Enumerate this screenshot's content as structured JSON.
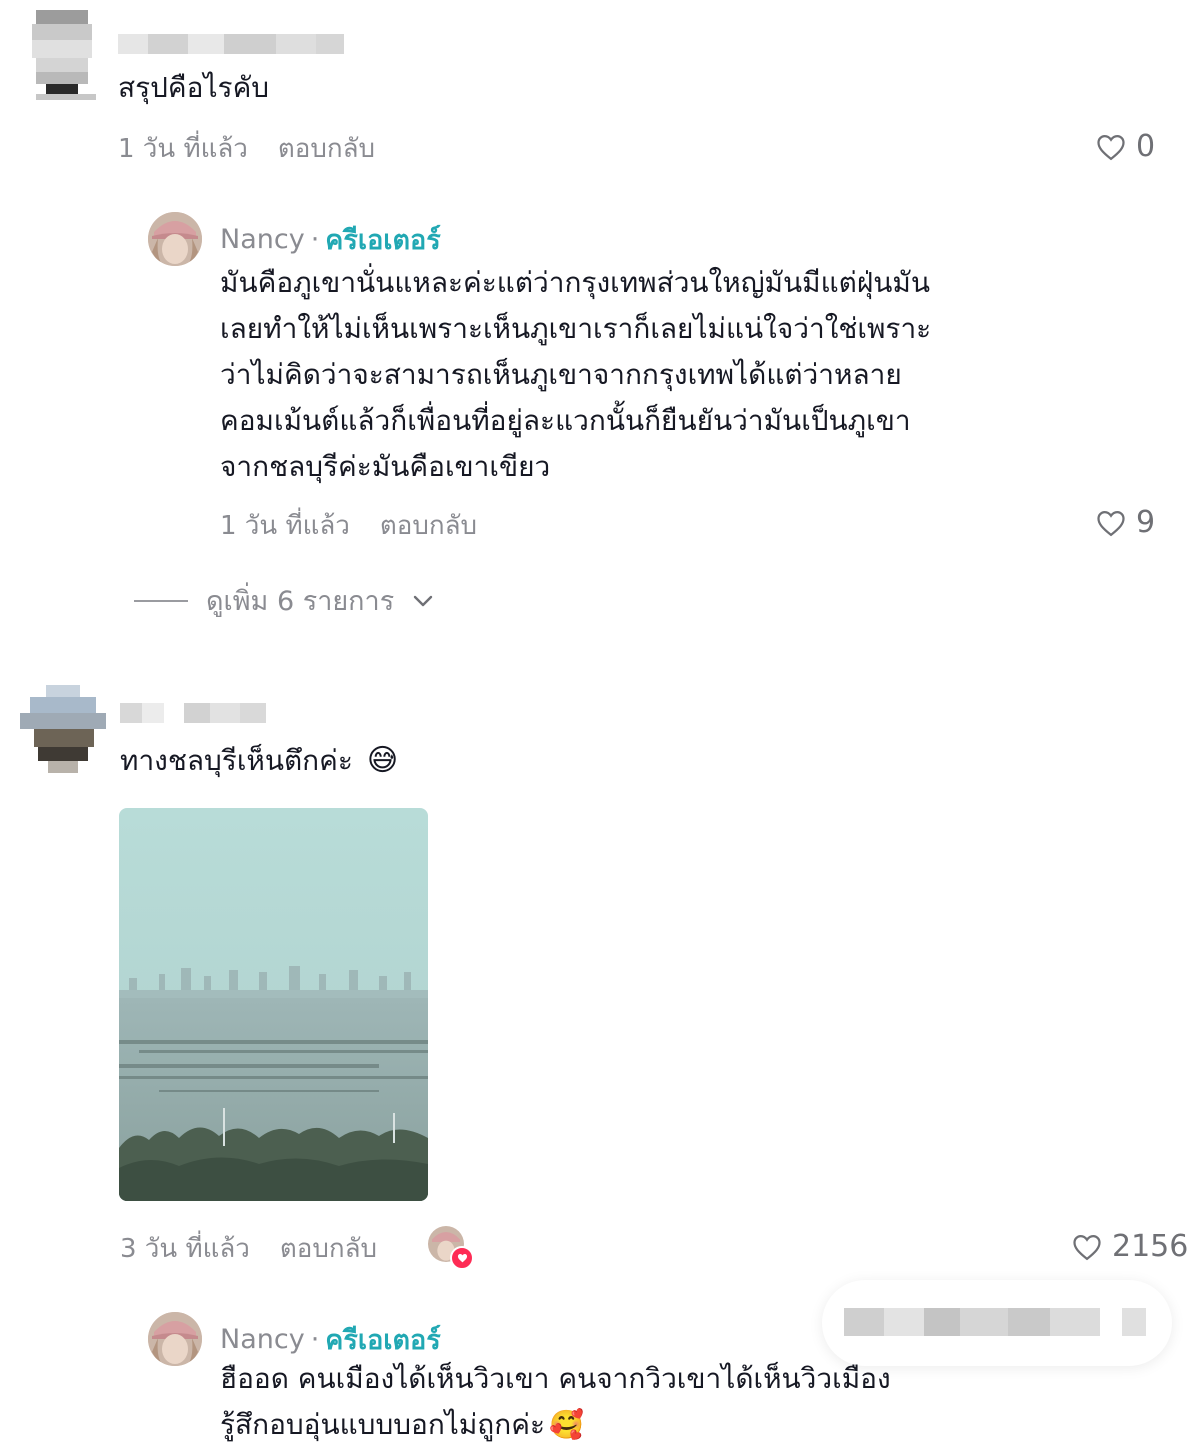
{
  "comments": [
    {
      "text": "สรุปคือไรคับ",
      "time": "1 วัน ที่แล้ว",
      "reply": "ตอบกลับ",
      "likes": "0",
      "replies": [
        {
          "name": "Nancy",
          "separator": "·",
          "badge": "ครีเอเตอร์",
          "lines": [
            "มันคือภูเขานั่นแหละค่ะแต่ว่ากรุงเทพส่วนใหญ่มันมีแต่ฝุ่นมัน",
            "เลยทำให้ไม่เห็นเพราะเห็นภูเขาเราก็เลยไม่แน่ใจว่าใช่เพราะ",
            "ว่าไม่คิดว่าจะสามารถเห็นภูเขาจากกรุงเทพได้แต่ว่าหลาย",
            "คอมเม้นต์แล้วก็เพื่อนที่อยู่ละแวกนั้นก็ยืนยันว่ามันเป็นภูเขา",
            "จากชลบุรีค่ะมันคือเขาเขียว"
          ],
          "time": "1 วัน ที่แล้ว",
          "reply": "ตอบกลับ",
          "likes": "9"
        }
      ],
      "view_more": "ดูเพิ่ม 6 รายการ"
    },
    {
      "text": "ทางชลบุรีเห็นตึกค่ะ",
      "emoji": "😅",
      "time": "3 วัน ที่แล้ว",
      "reply": "ตอบกลับ",
      "likes": "2156",
      "replies": [
        {
          "name": "Nancy",
          "separator": "·",
          "badge": "ครีเอเตอร์",
          "lines": [
            "ฮืออด คนเมืองได้เห็นวิวเขา คนจากวิวเขาได้เห็นวิวเมือง",
            "รู้สึกอบอุ่นแบบบอกไม่ถูกค่ะ"
          ],
          "emoji": "🥰"
        }
      ]
    }
  ],
  "icons": {
    "heart": "heart-icon",
    "chevron": "chevron-down-icon"
  },
  "colors": {
    "creator_badge": "#21a8b3",
    "meta_text": "#8a8b91",
    "text": "#161823"
  }
}
